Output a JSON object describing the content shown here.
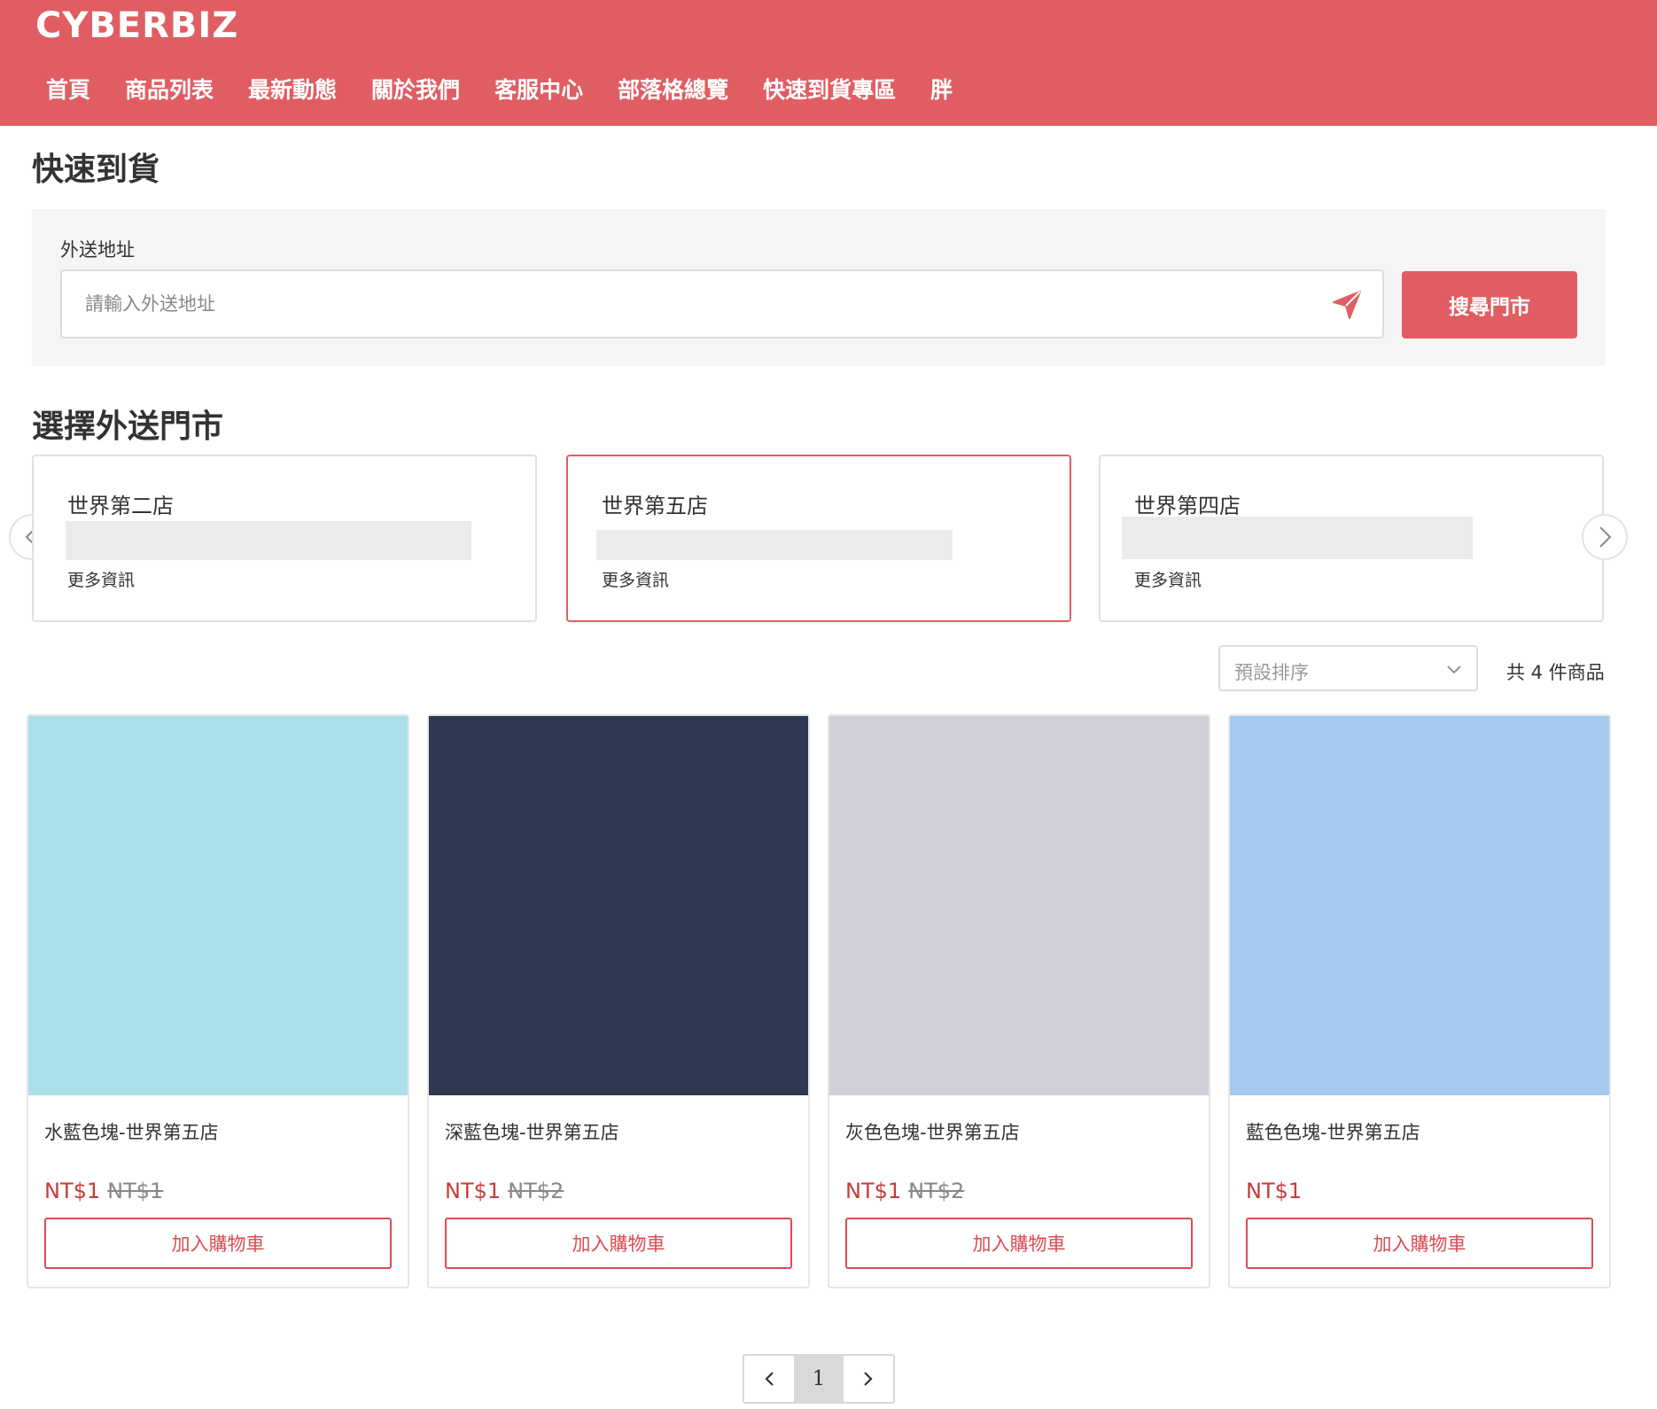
{
  "header": {
    "logo": "CYBERBIZ",
    "nav": [
      "首頁",
      "商品列表",
      "最新動態",
      "關於我們",
      "客服中心",
      "部落格總覽",
      "快速到貨專區",
      "胖"
    ]
  },
  "page_title": "快速到貨",
  "address": {
    "label": "外送地址",
    "placeholder": "請輸入外送地址",
    "value": "",
    "search_label": "搜尋門市"
  },
  "stores": {
    "title": "選擇外送門市",
    "items": [
      {
        "name": "世界第二店",
        "more": "更多資訊",
        "selected": false
      },
      {
        "name": "世界第五店",
        "more": "更多資訊",
        "selected": true
      },
      {
        "name": "世界第四店",
        "more": "更多資訊",
        "selected": false
      }
    ]
  },
  "sort": {
    "selected": "預設排序",
    "count_text": "共 4 件商品"
  },
  "products": [
    {
      "name": "水藍色塊-世界第五店",
      "price": "NT$1",
      "old_price": "NT$1",
      "color": "#abdfea",
      "add_label": "加入購物車"
    },
    {
      "name": "深藍色塊-世界第五店",
      "price": "NT$1",
      "old_price": "NT$2",
      "color": "#2f3853",
      "add_label": "加入購物車"
    },
    {
      "name": "灰色色塊-世界第五店",
      "price": "NT$1",
      "old_price": "NT$2",
      "color": "#cfd0d8",
      "add_label": "加入購物車"
    },
    {
      "name": "藍色色塊-世界第五店",
      "price": "NT$1",
      "old_price": "",
      "color": "#a6c9f1",
      "add_label": "加入購物車"
    }
  ],
  "pagination": {
    "current": "1"
  },
  "colors": {
    "brand": "#e05e63",
    "price": "#c73a3a"
  }
}
